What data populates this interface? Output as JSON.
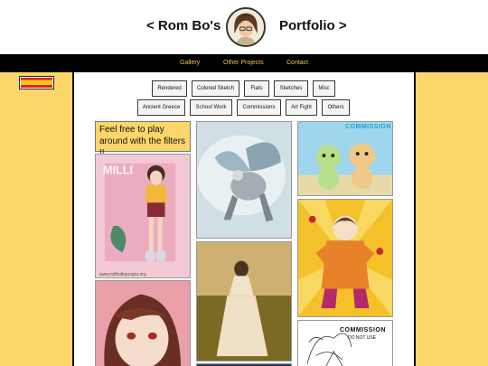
{
  "header": {
    "title_left": "< Rom Bo's",
    "title_right": "Portfolio >",
    "avatar_icon": "avatar-portrait-icon"
  },
  "nav": {
    "items": [
      "Gallery",
      "Other Projects",
      "Contact"
    ]
  },
  "language_flag": {
    "icon": "spain-flag-icon",
    "colors": [
      "#d22222",
      "#f5c518"
    ]
  },
  "filters": {
    "row1": [
      "Rendered",
      "Colored Sketch",
      "Flats",
      "Sketches",
      "Misc"
    ],
    "row2": [
      "Ancient Greece",
      "School Work",
      "Commissions",
      "Art Fight",
      "Others"
    ]
  },
  "note": "Feel free to play around with the filters !!",
  "gallery": {
    "col1_top_caption": "MILLI",
    "col1_top_watermark": "www.milbotlopropia.org",
    "col3_top_stamp": "COMMISSION",
    "col3_bottom_stamp": "COMMISSION",
    "col3_bottom_substamp": "DO NOT USE"
  },
  "colors": {
    "accent_yellow": "#fcd66a",
    "nav_link": "#f5c542",
    "navbar_bg": "#000000"
  }
}
